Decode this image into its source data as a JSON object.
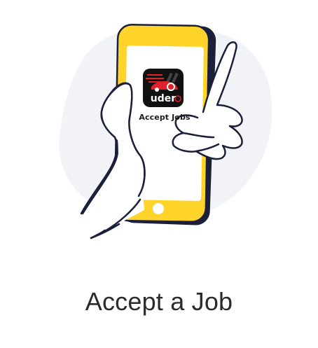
{
  "app": {
    "brand": "uder",
    "caption": "Accept Jobs",
    "icon_name": "uder-app-icon"
  },
  "heading": "Accept a Job",
  "colors": {
    "phone_yellow": "#FFD42A",
    "phone_outline": "#1c1f3a",
    "backdrop": "#F2F3F7",
    "brand_red": "#E0202B",
    "icon_bg": "#111111",
    "heading_text": "#2b2b2b"
  },
  "illustration": {
    "name": "hand-holding-phone",
    "button_icon": "home-button-icon"
  }
}
